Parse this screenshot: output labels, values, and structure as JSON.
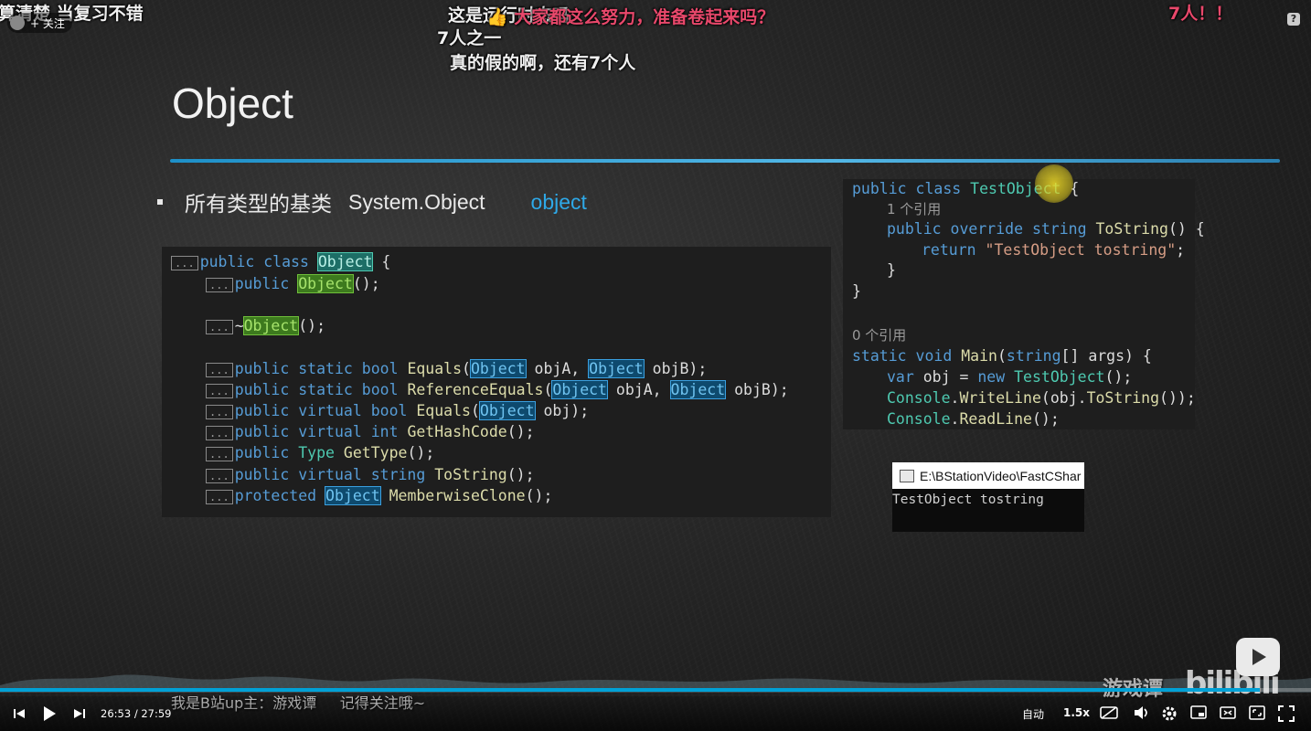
{
  "danmaku": {
    "top_left": "算清楚   当复习不错",
    "top_center": "这是运行时态吗",
    "top_pink": "👍 大家都这么努力，准备卷起来吗？",
    "second": "7人之一",
    "third": "真的假的啊，还有7个人",
    "top_right": "7人！！"
  },
  "follow": {
    "label": "+ 关注"
  },
  "slide": {
    "title": "Object",
    "bullet_cn": "所有类型的基类",
    "bullet_sys": "System.Object",
    "bullet_kw": "object"
  },
  "left_code": {
    "line1_a": "public class ",
    "line1_obj": "Object",
    "line1_b": " {",
    "ctor_a": "public ",
    "ctor_obj": "Object",
    "ctor_b": "();",
    "dtor_a": "~",
    "dtor_obj": "Object",
    "dtor_b": "();",
    "eq_a": "public static bool ",
    "eq_f": "Equals",
    "eq_p1": "Object",
    "eq_m": " objA, ",
    "eq_p2": "Object",
    "eq_e": " objB);",
    "req_a": "public static bool ",
    "req_f": "ReferenceEquals",
    "req_p1": "Object",
    "req_m": " objA, ",
    "req_p2": "Object",
    "req_e": " objB);",
    "veq_a": "public virtual bool ",
    "veq_f": "Equals",
    "veq_p": "Object",
    "veq_e": " obj);",
    "hash_a": "public virtual int ",
    "hash_f": "GetHashCode",
    "hash_e": "();",
    "type_a": "public ",
    "type_t": "Type",
    "type_f": " GetType",
    "type_e": "();",
    "str_a": "public virtual string ",
    "str_f": "ToString",
    "str_e": "();",
    "mem_a": "protected ",
    "mem_obj": "Object",
    "mem_f": " MemberwiseClone",
    "mem_e": "();",
    "fold": "..."
  },
  "right_code": {
    "l1_a": "public class ",
    "l1_t": "TestObject",
    "l1_b": " {",
    "ref1": "1 个引用",
    "l2_a": "public override string ",
    "l2_f": "ToString",
    "l2_b": "() {",
    "l3_a": "return ",
    "l3_s": "\"TestObject tostring\"",
    "l3_b": ";",
    "l4": "}",
    "l5": "}",
    "ref0": "0 个引用",
    "m1_a": "static void ",
    "m1_f": "Main",
    "m1_b": "(",
    "m1_k": "string",
    "m1_c": "[] args) {",
    "m2_a": "var ",
    "m2_b": "obj = ",
    "m2_k": "new ",
    "m2_t": "TestObject",
    "m2_c": "();",
    "m3_t": "Console",
    "m3_a": ".",
    "m3_f": "WriteLine",
    "m3_b": "(obj.",
    "m3_f2": "ToString",
    "m3_c": "());",
    "m4_t": "Console",
    "m4_a": ".",
    "m4_f": "ReadLine",
    "m4_b": "();"
  },
  "console": {
    "title": "E:\\BStationVideo\\FastCShar",
    "output": "TestObject tostring"
  },
  "subtitle": "我是B站up主：游戏谭     记得关注哦~",
  "watermark": "游戏谭",
  "bili_logo": "bilibili",
  "player": {
    "time_current": "26:53",
    "time_sep": "/",
    "time_total": "27:59",
    "progress_fraction": 0.9607,
    "quality": "自动",
    "speed": "1.5x",
    "help_icon": "?"
  }
}
